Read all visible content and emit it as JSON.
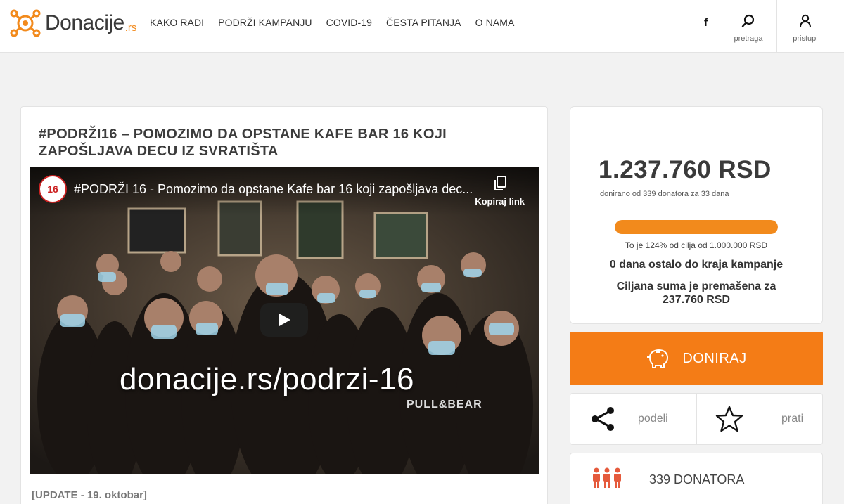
{
  "brand": {
    "name": "Donacije",
    "tld": ".rs",
    "accent": "#f28a1c"
  },
  "nav": [
    {
      "label": "KAKO RADI"
    },
    {
      "label": "PODRŽI KAMPANJU"
    },
    {
      "label": "COVID-19"
    },
    {
      "label": "ČESTA PITANJA"
    },
    {
      "label": "O NAMA"
    }
  ],
  "header": {
    "facebook_label": "f",
    "search_label": "pretraga",
    "login_label": "pristupi"
  },
  "campaign": {
    "title": "#PODRŽI16 – POMOZIMO DA OPSTANE KAFE BAR 16 KOJI ZAPOŠLJAVA DECU IZ SVRATIŠTA",
    "video": {
      "channel_initials": "16",
      "title": "#PODRŽI 16 - Pomozimo da opstane Kafe bar 16 koji zapošljava dec...",
      "copy_label": "Kopiraj link",
      "caption": "donacije.rs/podrzi-16",
      "shirt_text": "PULL&BEAR"
    },
    "update_label": "[UPDATE - 19. oktobar]"
  },
  "stats": {
    "amount": "1.237.760 RSD",
    "donated_note": "donirano od 339 donatora za 33 dana",
    "progress_fraction": 1.0,
    "percent_note": "To je 124% od cilja od 1.000.000 RSD",
    "days_left": "0 dana ostalo do kraja kampanje",
    "exceeded": "Ciljana suma je premašena za 237.760 RSD"
  },
  "actions": {
    "donate_label": "DONIRAJ",
    "share_label": "podeli",
    "follow_label": "prati"
  },
  "donors": {
    "label": "339 DONATORA"
  },
  "colors": {
    "orange": "#f47c16",
    "donor_icon": "#e55a3c"
  }
}
